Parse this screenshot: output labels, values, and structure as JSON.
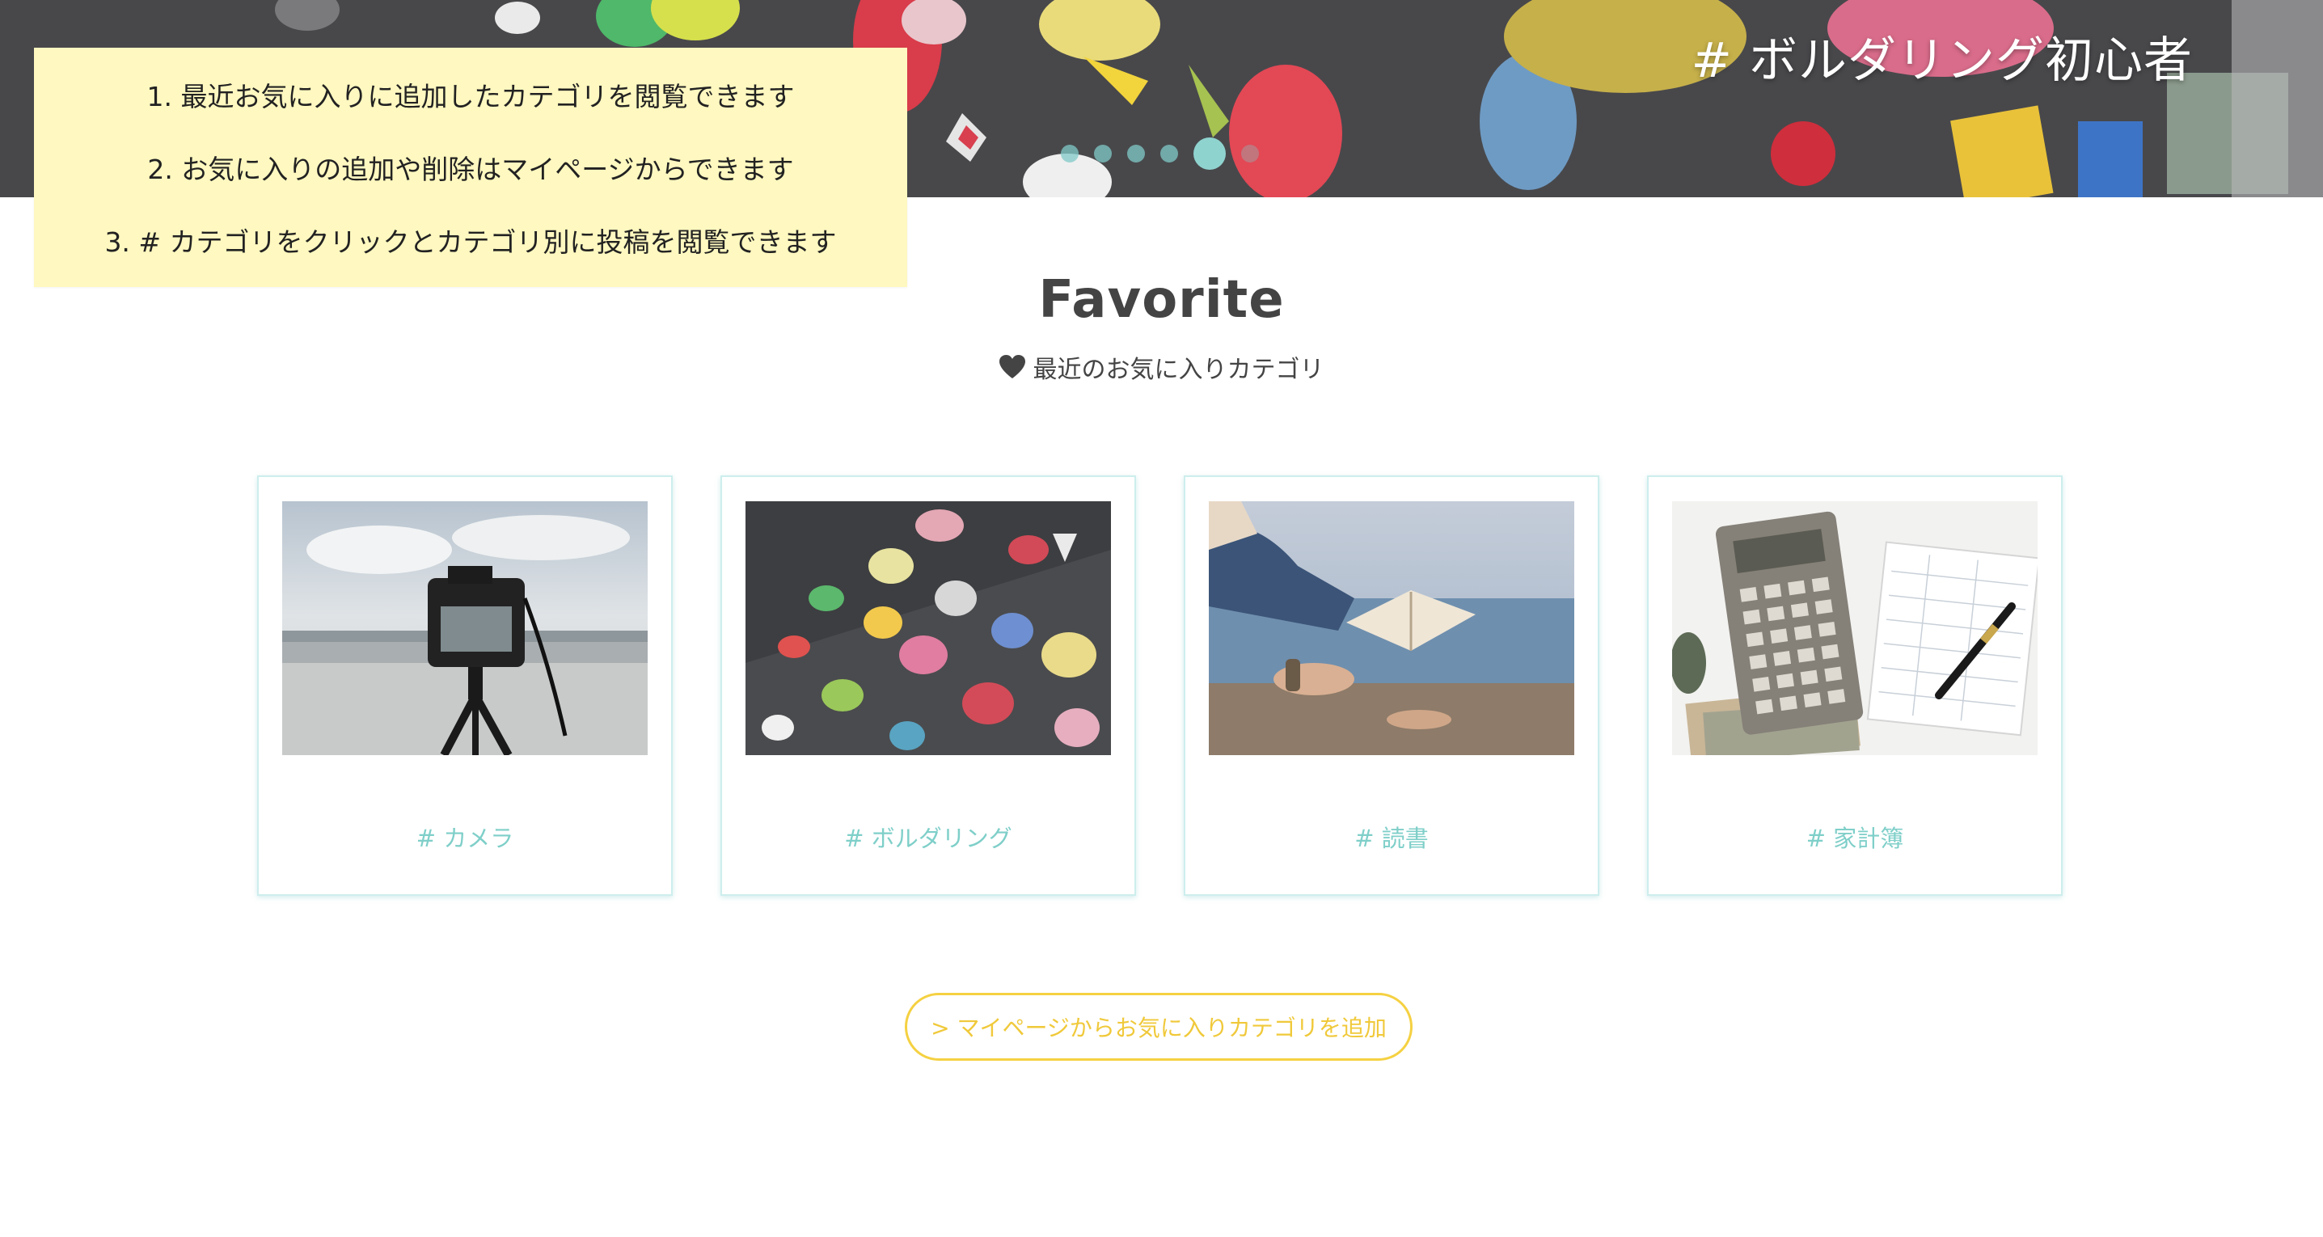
{
  "hero": {
    "title": "# ボルダリング初心者",
    "slider_dots": 6,
    "active_dot": 5
  },
  "info_note": {
    "lines": [
      "1. 最近お気に入りに追加したカテゴリを閲覧できます",
      "2. お気に入りの追加や削除はマイページからできます",
      "3. # カテゴリをクリックとカテゴリ別に投稿を閲覧できます"
    ]
  },
  "favorite": {
    "title": "Favorite",
    "subtitle": "最近のお気に入りカテゴリ",
    "subtitle_icon": "heart-icon"
  },
  "cards": [
    {
      "label": "# カメラ",
      "image": "camera-photo"
    },
    {
      "label": "# ボルダリング",
      "image": "climbing-wall-photo"
    },
    {
      "label": "# 読書",
      "image": "reading-book-photo"
    },
    {
      "label": "# 家計簿",
      "image": "calculator-notebook-photo"
    }
  ],
  "actions": {
    "add_favorite": "> マイページからお気に入りカテゴリを追加"
  },
  "colors": {
    "accent_teal": "#7fcfc9",
    "accent_yellow": "#f5d142",
    "note_background": "#fff8c0",
    "text": "#444444"
  }
}
